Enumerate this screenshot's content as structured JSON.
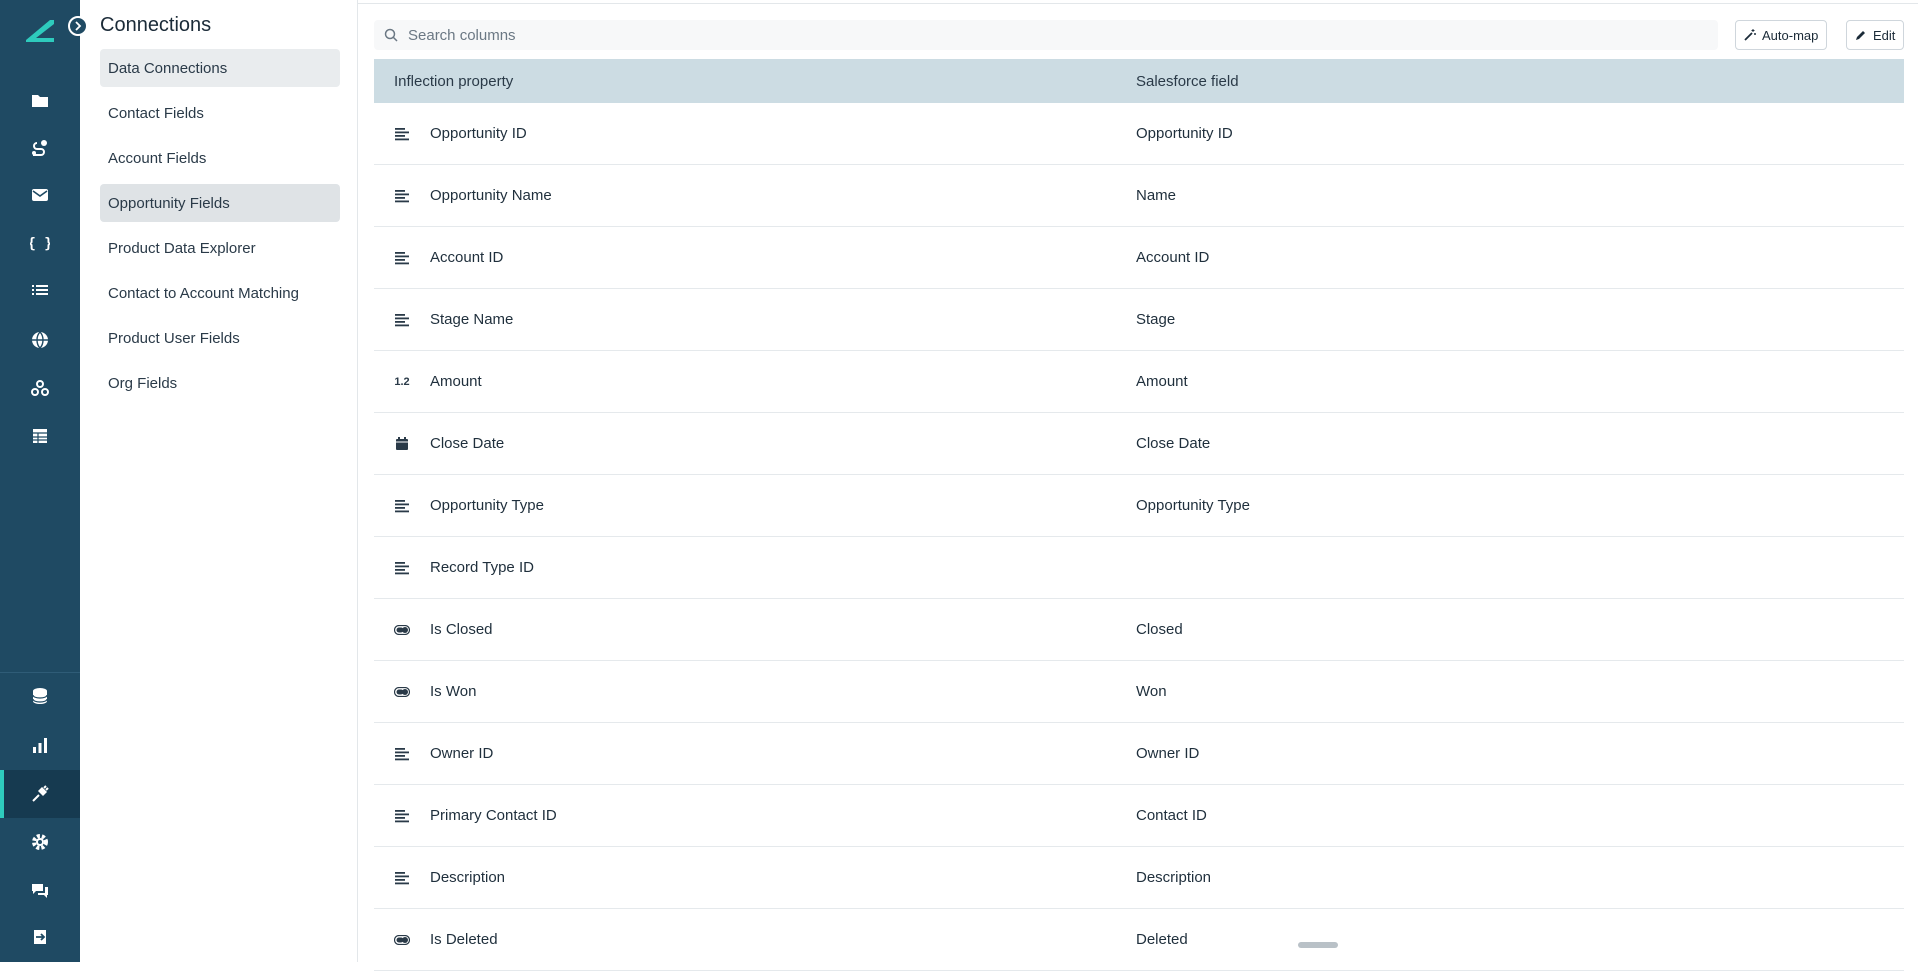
{
  "app": {
    "title": "Connections"
  },
  "subnav": {
    "items": [
      {
        "label": "Data Connections"
      },
      {
        "label": "Contact Fields"
      },
      {
        "label": "Account Fields"
      },
      {
        "label": "Opportunity Fields"
      },
      {
        "label": "Product Data Explorer"
      },
      {
        "label": "Contact to Account Matching"
      },
      {
        "label": "Product User Fields"
      },
      {
        "label": "Org Fields"
      }
    ]
  },
  "toolbar": {
    "search_placeholder": "Search columns",
    "automap_label": "Auto-map",
    "edit_label": "Edit"
  },
  "table": {
    "headers": {
      "col1": "Inflection property",
      "col2": "Salesforce field"
    },
    "rows": [
      {
        "type": "text",
        "type_icon": "text-lines-icon",
        "property": "Opportunity ID",
        "field": "Opportunity ID"
      },
      {
        "type": "text",
        "type_icon": "text-lines-icon",
        "property": "Opportunity Name",
        "field": "Name"
      },
      {
        "type": "text",
        "type_icon": "text-lines-icon",
        "property": "Account ID",
        "field": "Account ID"
      },
      {
        "type": "text",
        "type_icon": "text-lines-icon",
        "property": "Stage Name",
        "field": "Stage"
      },
      {
        "type": "number",
        "type_icon": "number-icon",
        "type_label": "1.2",
        "property": "Amount",
        "field": "Amount"
      },
      {
        "type": "date",
        "type_icon": "calendar-icon",
        "property": "Close Date",
        "field": "Close Date"
      },
      {
        "type": "text",
        "type_icon": "text-lines-icon",
        "property": "Opportunity Type",
        "field": "Opportunity Type"
      },
      {
        "type": "text",
        "type_icon": "text-lines-icon",
        "property": "Record Type ID",
        "field": ""
      },
      {
        "type": "boolean",
        "type_icon": "toggle-icon",
        "property": "Is Closed",
        "field": "Closed"
      },
      {
        "type": "boolean",
        "type_icon": "toggle-icon",
        "property": "Is Won",
        "field": "Won"
      },
      {
        "type": "text",
        "type_icon": "text-lines-icon",
        "property": "Owner ID",
        "field": "Owner ID"
      },
      {
        "type": "text",
        "type_icon": "text-lines-icon",
        "property": "Primary Contact ID",
        "field": "Contact ID"
      },
      {
        "type": "text",
        "type_icon": "text-lines-icon",
        "property": "Description",
        "field": "Description"
      },
      {
        "type": "boolean",
        "type_icon": "toggle-icon",
        "property": "Is Deleted",
        "field": "Deleted"
      }
    ]
  },
  "rail": {
    "icons": [
      "folder-icon",
      "journey-icon",
      "mail-icon",
      "braces-icon",
      "list-icon",
      "globe-icon",
      "webhook-icon",
      "table-icon",
      "database-icon",
      "bar-chart-icon",
      "plug-icon",
      "gear-icon",
      "chat-icon",
      "logout-icon"
    ],
    "active": "plug-icon"
  },
  "colors": {
    "rail": "#1f4a63",
    "accent": "#2ecbbd",
    "table_header": "#ccdce3",
    "selected_nav": "#dfe3e6"
  }
}
